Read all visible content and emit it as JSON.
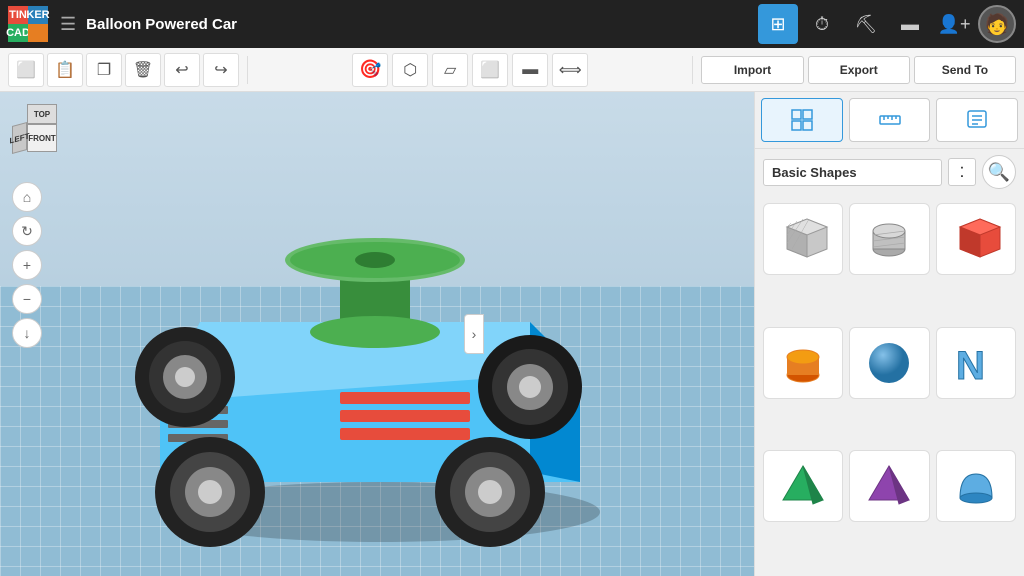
{
  "topbar": {
    "logo": [
      {
        "letter": "TIN",
        "class": "logo-tl"
      },
      {
        "letter": "KER",
        "class": "logo-tr"
      },
      {
        "letter": "CAD",
        "class": "logo-bl"
      },
      {
        "letter": "",
        "class": "logo-br"
      }
    ],
    "title": "Balloon Powered Car",
    "icons": [
      {
        "name": "grid-view-icon",
        "symbol": "⊞",
        "active": true
      },
      {
        "name": "timer-icon",
        "symbol": "⏱",
        "active": false
      },
      {
        "name": "hammer-icon",
        "symbol": "🔨",
        "active": false
      },
      {
        "name": "blocks-icon",
        "symbol": "▪",
        "active": false
      },
      {
        "name": "add-person-icon",
        "symbol": "👤",
        "active": false
      }
    ]
  },
  "toolbar": {
    "left_tools": [
      {
        "name": "copy-tool",
        "symbol": "⬜"
      },
      {
        "name": "paste-tool",
        "symbol": "📋"
      },
      {
        "name": "duplicate-tool",
        "symbol": "❐"
      },
      {
        "name": "delete-tool",
        "symbol": "🗑"
      },
      {
        "name": "undo-tool",
        "symbol": "↩"
      },
      {
        "name": "redo-tool",
        "symbol": "↪"
      }
    ],
    "center_tools": [
      {
        "name": "camera-tool",
        "symbol": "🎯"
      },
      {
        "name": "pin-tool",
        "symbol": "⬡"
      },
      {
        "name": "note-tool",
        "symbol": "▱"
      },
      {
        "name": "shape-tool",
        "symbol": "⬜"
      },
      {
        "name": "align-tool",
        "symbol": "⬛"
      },
      {
        "name": "mirror-tool",
        "symbol": "⟺"
      }
    ],
    "right_tools": [
      {
        "name": "import-btn",
        "label": "Import"
      },
      {
        "name": "export-btn",
        "label": "Export"
      },
      {
        "name": "sendto-btn",
        "label": "Send To"
      }
    ]
  },
  "right_panel": {
    "actions": [
      "Import",
      "Export",
      "Send To"
    ],
    "tools": [
      {
        "name": "grid-tool",
        "symbol": "⊞"
      },
      {
        "name": "ruler-tool",
        "symbol": "📐"
      },
      {
        "name": "notes-tool",
        "symbol": "📝"
      }
    ],
    "shapes_title": "Basic Shapes",
    "sort_symbol": "⁚",
    "search_symbol": "🔍",
    "shapes": [
      {
        "name": "box-shape",
        "symbol": "📦",
        "color": "#aaa"
      },
      {
        "name": "cylinder-shape",
        "symbol": "🔷",
        "color": "#aaa"
      },
      {
        "name": "box-red-shape",
        "symbol": "🟥",
        "color": "#e74c3c"
      },
      {
        "name": "cylinder-orange-shape",
        "symbol": "🟠",
        "color": "#e67e22"
      },
      {
        "name": "sphere-shape",
        "symbol": "🔵",
        "color": "#5dade2"
      },
      {
        "name": "text-shape",
        "symbol": "N",
        "color": "#85c1e9"
      },
      {
        "name": "pyramid-green-shape",
        "symbol": "🟢",
        "color": "#27ae60"
      },
      {
        "name": "pyramid-purple-shape",
        "symbol": "🟣",
        "color": "#8e44ad"
      },
      {
        "name": "halfcylinder-shape",
        "symbol": "⚪",
        "color": "#5dade2"
      }
    ]
  },
  "orient_cube": {
    "top_label": "TOP",
    "front_label": "FRONT",
    "left_label": "LEFT"
  },
  "collapse_btn": "›"
}
